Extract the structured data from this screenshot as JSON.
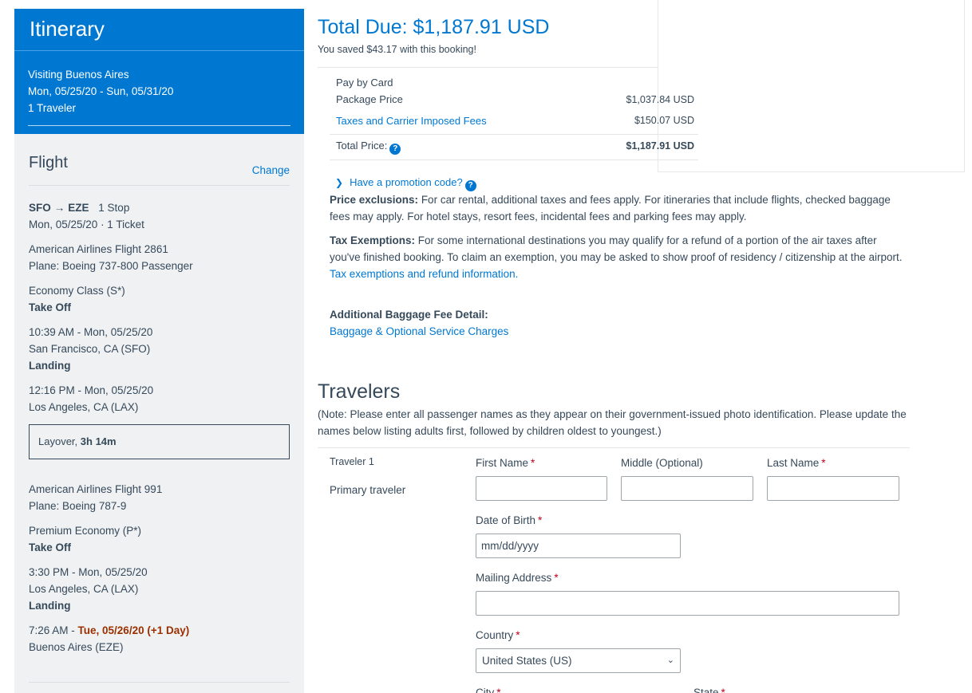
{
  "itinerary": {
    "title": "Itinerary",
    "destination": "Visiting Buenos Aires",
    "dates": "Mon, 05/25/20 - Sun, 05/31/20",
    "travelers": "1 Traveler"
  },
  "flight": {
    "title": "Flight",
    "change_label": "Change",
    "route_from": "SFO",
    "route_to": "EZE",
    "stops": "1 Stop",
    "date_ticket": "Mon, 05/25/20 · 1 Ticket",
    "seg1": {
      "flight": "American Airlines Flight 2861",
      "plane": "Plane: Boeing 737-800 Passenger",
      "cabin": "Economy Class (S*)",
      "takeoff_label": "Take Off",
      "takeoff_time": "10:39 AM - Mon, 05/25/20",
      "takeoff_place": "San Francisco, CA (SFO)",
      "landing_label": "Landing",
      "landing_time": "12:16 PM - Mon, 05/25/20",
      "landing_place": "Los Angeles, CA (LAX)"
    },
    "layover_label": "Layover,",
    "layover_duration": "3h 14m",
    "seg2": {
      "flight": "American Airlines Flight 991",
      "plane": "Plane: Boeing 787-9",
      "cabin": "Premium Economy (P*)",
      "takeoff_label": "Take Off",
      "takeoff_time": "3:30 PM - Mon, 05/25/20",
      "takeoff_place": "Los Angeles, CA (LAX)",
      "landing_label": "Landing",
      "landing_time_prefix": "7:26 AM - ",
      "landing_time_highlight": "Tue, 05/26/20 (+1 Day)",
      "landing_place": "Buenos Aires (EZE)"
    }
  },
  "summary": {
    "total_due_label": "Total Due:",
    "total_due_amount": "$1,187.91 USD",
    "saved_text": "You saved $43.17 with this booking!",
    "pay_by": "Pay by Card",
    "package_price_label": "Package Price",
    "package_price_value": "$1,037.84 USD",
    "taxes_label": "Taxes and Carrier Imposed Fees",
    "taxes_value": "$150.07 USD",
    "total_price_label": "Total Price:",
    "total_price_value": "$1,187.91 USD",
    "help_icon": "?",
    "promo_label": "Have a promotion code?"
  },
  "notices": {
    "price_exclusions_label": "Price exclusions:",
    "price_exclusions_text": " For car rental, additional taxes and fees apply. For itineraries that include flights, checked baggage fees may apply. For hotel stays, resort fees, incidental fees and parking fees may apply.",
    "tax_exemptions_label": "Tax Exemptions:",
    "tax_exemptions_text": " For some international destinations you may qualify for a refund of a portion of the air taxes after you've finished booking. To claim an exemption, you may be asked to show proof of residency / citizenship at the airport.",
    "tax_exemptions_link": "Tax exemptions and refund information.",
    "baggage_label": "Additional Baggage Fee Detail:",
    "baggage_link": "Baggage & Optional Service Charges"
  },
  "travelers": {
    "title": "Travelers",
    "note": "(Note: Please enter all passenger names as they appear on their government-issued photo identification. Please update the names below listing adults first, followed by children oldest to youngest.)",
    "traveler_label": "Traveler 1",
    "traveler_role": "Primary traveler",
    "first_name_label": "First Name",
    "middle_name_label": "Middle (Optional)",
    "last_name_label": "Last Name",
    "dob_label": "Date of Birth",
    "dob_placeholder": "mm/dd/yyyy",
    "address_label": "Mailing Address",
    "country_label": "Country",
    "country_value": "United States (US)",
    "city_label": "City",
    "state_label": "State",
    "required_mark": "*"
  },
  "colors": {
    "brand_blue": "#0078d2",
    "sidebar_bg": "#eff1f3",
    "text": "#36495a",
    "required": "#c30019",
    "highlight": "#9a3000"
  }
}
